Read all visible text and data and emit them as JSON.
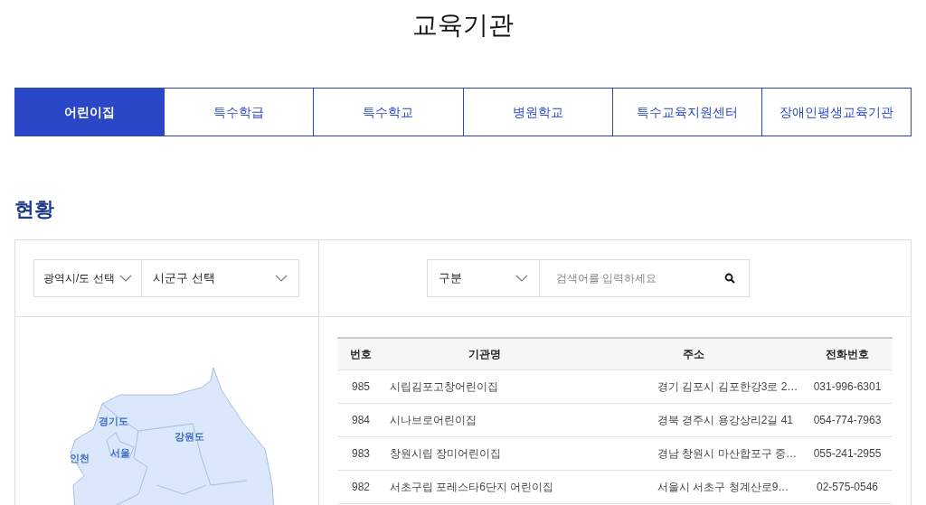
{
  "title": "교육기관",
  "tabs": [
    {
      "label": "어린이집",
      "selected": true
    },
    {
      "label": "특수학급",
      "selected": false
    },
    {
      "label": "특수학교",
      "selected": false
    },
    {
      "label": "병원학교",
      "selected": false
    },
    {
      "label": "특수교육지원센터",
      "selected": false
    },
    {
      "label": "장애인평생교육기관",
      "selected": false
    }
  ],
  "section_title": "현황",
  "filters": {
    "region_select": "광역시/도 선택",
    "district_select": "시군구 선택"
  },
  "search": {
    "category_select": "구분",
    "placeholder": "검색어를 입력하세요"
  },
  "map": {
    "labels": [
      "경기도",
      "강원도",
      "서울",
      "인천"
    ]
  },
  "table": {
    "columns": [
      "번호",
      "기관명",
      "주소",
      "전화번호"
    ],
    "rows": [
      [
        "985",
        "시립김포고창어린이집",
        "경기 김포시 김포한강3로 2…",
        "031-996-6301"
      ],
      [
        "984",
        "시나브로어린이집",
        "경북 경주시 용강상리2길 41",
        "054-774-7963"
      ],
      [
        "983",
        "창원시립 장미어린이집",
        "경남 창원시 마산합포구 중…",
        "055-241-2955"
      ],
      [
        "982",
        "서초구립 포레스타6단지 어린이집",
        "서울시 서초구 청계산로9…",
        "02-575-0546"
      ]
    ]
  }
}
